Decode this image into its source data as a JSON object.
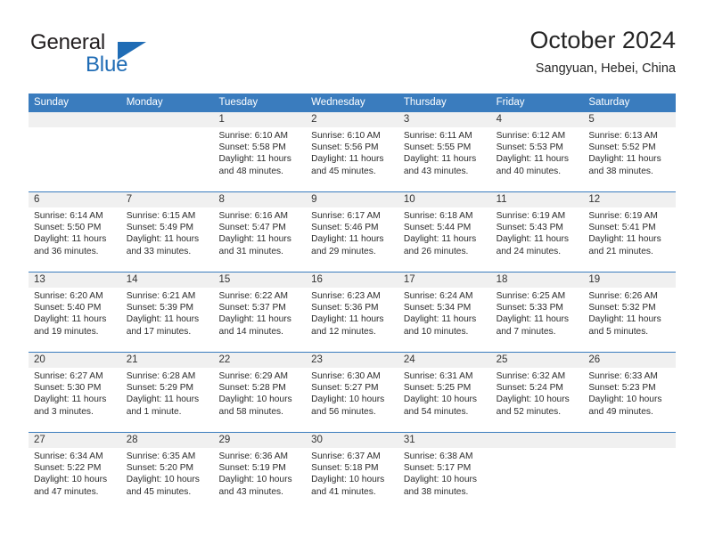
{
  "brand": {
    "name_part1": "General",
    "name_part2": "Blue",
    "accent_color": "#1f6cb5"
  },
  "header": {
    "title": "October 2024",
    "location": "Sangyuan, Hebei, China"
  },
  "calendar": {
    "header_color": "#3a7cbe",
    "weekdays": [
      "Sunday",
      "Monday",
      "Tuesday",
      "Wednesday",
      "Thursday",
      "Friday",
      "Saturday"
    ],
    "weeks": [
      [
        {
          "day": "",
          "sunrise": "",
          "sunset": "",
          "daylight": ""
        },
        {
          "day": "",
          "sunrise": "",
          "sunset": "",
          "daylight": ""
        },
        {
          "day": "1",
          "sunrise": "Sunrise: 6:10 AM",
          "sunset": "Sunset: 5:58 PM",
          "daylight": "Daylight: 11 hours and 48 minutes."
        },
        {
          "day": "2",
          "sunrise": "Sunrise: 6:10 AM",
          "sunset": "Sunset: 5:56 PM",
          "daylight": "Daylight: 11 hours and 45 minutes."
        },
        {
          "day": "3",
          "sunrise": "Sunrise: 6:11 AM",
          "sunset": "Sunset: 5:55 PM",
          "daylight": "Daylight: 11 hours and 43 minutes."
        },
        {
          "day": "4",
          "sunrise": "Sunrise: 6:12 AM",
          "sunset": "Sunset: 5:53 PM",
          "daylight": "Daylight: 11 hours and 40 minutes."
        },
        {
          "day": "5",
          "sunrise": "Sunrise: 6:13 AM",
          "sunset": "Sunset: 5:52 PM",
          "daylight": "Daylight: 11 hours and 38 minutes."
        }
      ],
      [
        {
          "day": "6",
          "sunrise": "Sunrise: 6:14 AM",
          "sunset": "Sunset: 5:50 PM",
          "daylight": "Daylight: 11 hours and 36 minutes."
        },
        {
          "day": "7",
          "sunrise": "Sunrise: 6:15 AM",
          "sunset": "Sunset: 5:49 PM",
          "daylight": "Daylight: 11 hours and 33 minutes."
        },
        {
          "day": "8",
          "sunrise": "Sunrise: 6:16 AM",
          "sunset": "Sunset: 5:47 PM",
          "daylight": "Daylight: 11 hours and 31 minutes."
        },
        {
          "day": "9",
          "sunrise": "Sunrise: 6:17 AM",
          "sunset": "Sunset: 5:46 PM",
          "daylight": "Daylight: 11 hours and 29 minutes."
        },
        {
          "day": "10",
          "sunrise": "Sunrise: 6:18 AM",
          "sunset": "Sunset: 5:44 PM",
          "daylight": "Daylight: 11 hours and 26 minutes."
        },
        {
          "day": "11",
          "sunrise": "Sunrise: 6:19 AM",
          "sunset": "Sunset: 5:43 PM",
          "daylight": "Daylight: 11 hours and 24 minutes."
        },
        {
          "day": "12",
          "sunrise": "Sunrise: 6:19 AM",
          "sunset": "Sunset: 5:41 PM",
          "daylight": "Daylight: 11 hours and 21 minutes."
        }
      ],
      [
        {
          "day": "13",
          "sunrise": "Sunrise: 6:20 AM",
          "sunset": "Sunset: 5:40 PM",
          "daylight": "Daylight: 11 hours and 19 minutes."
        },
        {
          "day": "14",
          "sunrise": "Sunrise: 6:21 AM",
          "sunset": "Sunset: 5:39 PM",
          "daylight": "Daylight: 11 hours and 17 minutes."
        },
        {
          "day": "15",
          "sunrise": "Sunrise: 6:22 AM",
          "sunset": "Sunset: 5:37 PM",
          "daylight": "Daylight: 11 hours and 14 minutes."
        },
        {
          "day": "16",
          "sunrise": "Sunrise: 6:23 AM",
          "sunset": "Sunset: 5:36 PM",
          "daylight": "Daylight: 11 hours and 12 minutes."
        },
        {
          "day": "17",
          "sunrise": "Sunrise: 6:24 AM",
          "sunset": "Sunset: 5:34 PM",
          "daylight": "Daylight: 11 hours and 10 minutes."
        },
        {
          "day": "18",
          "sunrise": "Sunrise: 6:25 AM",
          "sunset": "Sunset: 5:33 PM",
          "daylight": "Daylight: 11 hours and 7 minutes."
        },
        {
          "day": "19",
          "sunrise": "Sunrise: 6:26 AM",
          "sunset": "Sunset: 5:32 PM",
          "daylight": "Daylight: 11 hours and 5 minutes."
        }
      ],
      [
        {
          "day": "20",
          "sunrise": "Sunrise: 6:27 AM",
          "sunset": "Sunset: 5:30 PM",
          "daylight": "Daylight: 11 hours and 3 minutes."
        },
        {
          "day": "21",
          "sunrise": "Sunrise: 6:28 AM",
          "sunset": "Sunset: 5:29 PM",
          "daylight": "Daylight: 11 hours and 1 minute."
        },
        {
          "day": "22",
          "sunrise": "Sunrise: 6:29 AM",
          "sunset": "Sunset: 5:28 PM",
          "daylight": "Daylight: 10 hours and 58 minutes."
        },
        {
          "day": "23",
          "sunrise": "Sunrise: 6:30 AM",
          "sunset": "Sunset: 5:27 PM",
          "daylight": "Daylight: 10 hours and 56 minutes."
        },
        {
          "day": "24",
          "sunrise": "Sunrise: 6:31 AM",
          "sunset": "Sunset: 5:25 PM",
          "daylight": "Daylight: 10 hours and 54 minutes."
        },
        {
          "day": "25",
          "sunrise": "Sunrise: 6:32 AM",
          "sunset": "Sunset: 5:24 PM",
          "daylight": "Daylight: 10 hours and 52 minutes."
        },
        {
          "day": "26",
          "sunrise": "Sunrise: 6:33 AM",
          "sunset": "Sunset: 5:23 PM",
          "daylight": "Daylight: 10 hours and 49 minutes."
        }
      ],
      [
        {
          "day": "27",
          "sunrise": "Sunrise: 6:34 AM",
          "sunset": "Sunset: 5:22 PM",
          "daylight": "Daylight: 10 hours and 47 minutes."
        },
        {
          "day": "28",
          "sunrise": "Sunrise: 6:35 AM",
          "sunset": "Sunset: 5:20 PM",
          "daylight": "Daylight: 10 hours and 45 minutes."
        },
        {
          "day": "29",
          "sunrise": "Sunrise: 6:36 AM",
          "sunset": "Sunset: 5:19 PM",
          "daylight": "Daylight: 10 hours and 43 minutes."
        },
        {
          "day": "30",
          "sunrise": "Sunrise: 6:37 AM",
          "sunset": "Sunset: 5:18 PM",
          "daylight": "Daylight: 10 hours and 41 minutes."
        },
        {
          "day": "31",
          "sunrise": "Sunrise: 6:38 AM",
          "sunset": "Sunset: 5:17 PM",
          "daylight": "Daylight: 10 hours and 38 minutes."
        },
        {
          "day": "",
          "sunrise": "",
          "sunset": "",
          "daylight": ""
        },
        {
          "day": "",
          "sunrise": "",
          "sunset": "",
          "daylight": ""
        }
      ]
    ]
  }
}
